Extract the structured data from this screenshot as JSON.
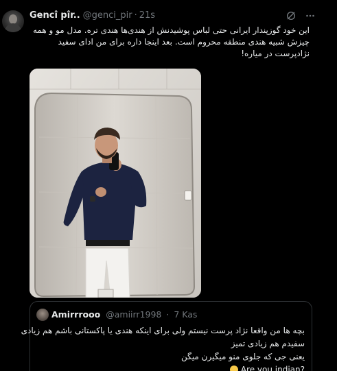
{
  "colors": {
    "background": "#000000",
    "text": "#e7e9ea",
    "muted": "#71767b",
    "border": "#2f3336"
  },
  "tweet": {
    "author_name": "Gencî pîr..",
    "author_handle": "@genci_pir",
    "separator": "·",
    "time": "21s",
    "text": "این خود گوزپندار ایرانی حتی لباس پوشیدنش از هندی‌ها هندی تره. مدل مو و همه چیزش شبیه هندی منطقه محروم است. بعد اینجا داره برای من ادای سفید نژادپرست در میاره!",
    "icons": {
      "grok": "grok-icon",
      "more": "more-options-icon"
    }
  },
  "media": {
    "description_icon": "mirror-selfie-photo"
  },
  "quote": {
    "author_name": "Amirrrooo",
    "author_handle": "@amiirr1998",
    "separator": "·",
    "time": "7 Kas",
    "lines": [
      "بچه ها من واقعا نژاد پرست نیستم ولی برای اینکه هندی یا پاکستانی باشم هم زیادی",
      "سفیدم هم زیادی تمیز",
      "یعنی جی که جلوی منو میگیرن میگن",
      "Are you indian?"
    ],
    "emoji": "grinning-face-with-sweat-emoji"
  }
}
